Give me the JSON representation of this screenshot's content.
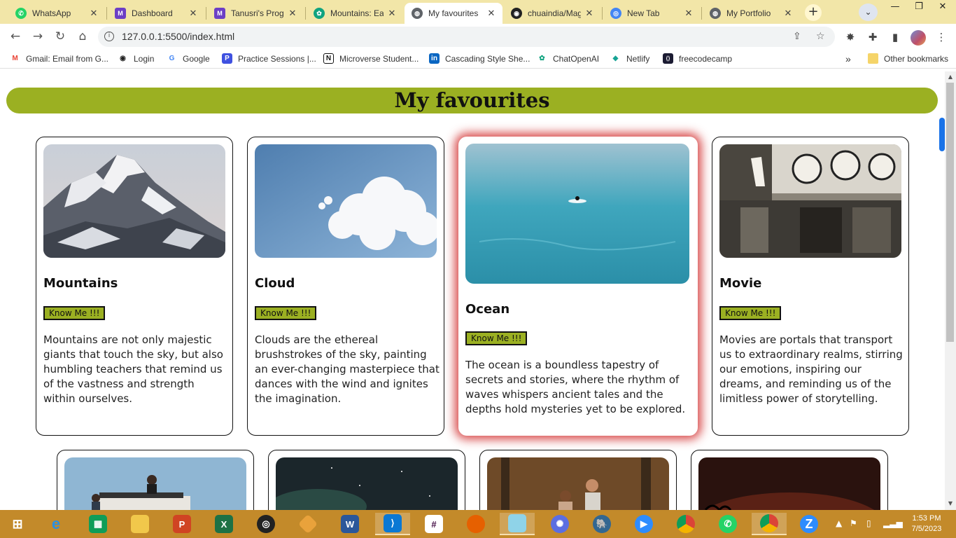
{
  "tabs": [
    {
      "title": "WhatsApp",
      "icon": "whatsapp-icon",
      "color": "#25d366"
    },
    {
      "title": "Dashboard",
      "icon": "microverse-icon",
      "color": "#6c3fc5"
    },
    {
      "title": "Tanusri's Progr",
      "icon": "microverse-icon",
      "color": "#6c3fc5"
    },
    {
      "title": "Mountains: Ea",
      "icon": "chatgpt-icon",
      "color": "#10a37f"
    },
    {
      "title": "My favourites",
      "icon": "globe-icon",
      "color": "#5f6368"
    },
    {
      "title": "chuaindia/Mag",
      "icon": "github-icon",
      "color": "#222222"
    },
    {
      "title": "New Tab",
      "icon": "chrome-icon",
      "color": "#4285f4"
    },
    {
      "title": "My Portfolio",
      "icon": "globe-icon",
      "color": "#5f6368"
    }
  ],
  "address_bar": {
    "url": "127.0.0.1:5500/index.html"
  },
  "bookmarks": [
    {
      "label": "Gmail: Email from G...",
      "icon": "gmail-icon",
      "glyph": "M",
      "color": "#ea4335"
    },
    {
      "label": "Login",
      "icon": "globe-icon",
      "glyph": "◉",
      "color": "#222222"
    },
    {
      "label": "Google",
      "icon": "google-icon",
      "glyph": "G",
      "color": "#4285f4"
    },
    {
      "label": "Practice Sessions |...",
      "icon": "practice-icon",
      "glyph": "P",
      "color": "#3f51e0"
    },
    {
      "label": "Microverse Student...",
      "icon": "notion-icon",
      "glyph": "N",
      "color": "#111111"
    },
    {
      "label": "Cascading Style She...",
      "icon": "linkedin-icon",
      "glyph": "in",
      "color": "#0a66c2"
    },
    {
      "label": "ChatOpenAI",
      "icon": "chatgpt-icon",
      "glyph": "✿",
      "color": "#10a37f"
    },
    {
      "label": "Netlify",
      "icon": "netlify-icon",
      "glyph": "◆",
      "color": "#16a394"
    },
    {
      "label": "freecodecamp",
      "icon": "freecodecamp-icon",
      "glyph": "⟨⟩",
      "color": "#1b1b32"
    }
  ],
  "bookmarks_overflow": "»",
  "other_bookmarks": "Other bookmarks",
  "page": {
    "heading": "My favourites",
    "cards": [
      {
        "title": "Mountains",
        "button": "Know Me !!!",
        "text": "Mountains are not only majestic giants that touch the sky, but also humbling teachers that remind us of the vastness and strength within ourselves."
      },
      {
        "title": "Cloud",
        "button": "Know Me !!!",
        "text": "Clouds are the ethereal brushstrokes of the sky, painting an ever-changing masterpiece that dances with the wind and ignites the imagination."
      },
      {
        "title": "Ocean",
        "button": "Know Me !!!",
        "text": "The ocean is a boundless tapestry of secrets and stories, where the rhythm of waves whispers ancient tales and the depths hold mysteries yet to be explored."
      },
      {
        "title": "Movie",
        "button": "Know Me !!!",
        "text": "Movies are portals that transport us to extraordinary realms, stirring our emotions, inspiring our dreams, and reminding us of the limitless power of storytelling."
      }
    ]
  },
  "taskbar": {
    "apps": [
      "start-icon",
      "internet-explorer-icon",
      "store-icon",
      "file-explorer-icon",
      "powerpoint-icon",
      "excel-icon",
      "obs-icon",
      "git-icon",
      "word-icon",
      "vscode-icon",
      "slack-icon",
      "firefox-icon",
      "notepad-icon",
      "chatgpt-icon",
      "postgres-icon",
      "zoom-icon",
      "chrome-icon",
      "whatsapp-icon",
      "chrome-profile-icon",
      "zoom-alt-icon"
    ],
    "time": "1:53 PM",
    "date": "7/5/2023"
  }
}
